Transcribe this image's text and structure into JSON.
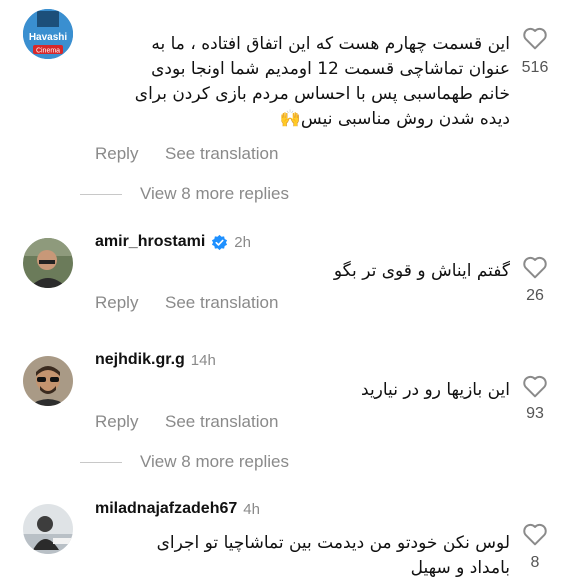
{
  "comments": [
    {
      "avatar_text": "Havashi",
      "avatar_badge": "Cinema",
      "lines": [
        "این قسمت چهارم هست که این اتفاق افتاده ، ما به",
        "عنوان تماشاچی قسمت 12 اومدیم شما اونجا بودی",
        "خانم طهماسبی پس با احساس مردم بازی کردن برای",
        "دیده شدن روش مناسبی نیس🙌"
      ],
      "reply": "Reply",
      "translate": "See translation",
      "likes": "516"
    },
    {
      "username": "amir_hrostami",
      "time": "2h",
      "text": "گفتم ایناش و قوی تر بگو",
      "reply": "Reply",
      "translate": "See translation",
      "likes": "26"
    },
    {
      "username": "nejhdik.gr.g",
      "time": "14h",
      "text": "این بازیها رو در نیارید",
      "reply": "Reply",
      "translate": "See translation",
      "likes": "93"
    },
    {
      "username": "miladnajafzadeh67",
      "time": "4h",
      "lines": [
        "لوس نکن خودتو من دیدمت بین تماشاچیا تو اجرای",
        "بامداد و سهیل"
      ],
      "likes": "8"
    }
  ],
  "view_more_1": "View 8 more replies",
  "view_more_2": "View 8 more replies",
  "colors": {
    "verified": "#1e90ff",
    "muted": "#8a8a8a",
    "divider": "#c8c8c8"
  }
}
